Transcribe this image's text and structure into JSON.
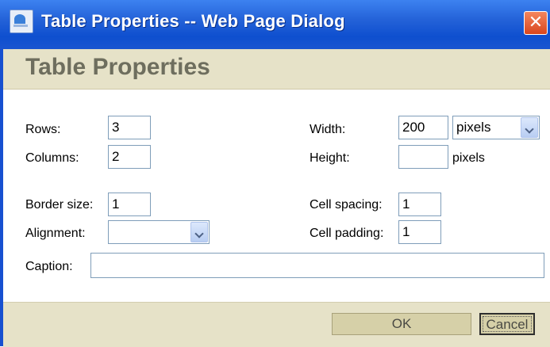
{
  "window": {
    "title": "Table Properties -- Web Page Dialog",
    "close_symbol": "✕",
    "icon": "dialog-app-icon"
  },
  "header": {
    "title": "Table Properties"
  },
  "form": {
    "rows": {
      "label": "Rows:",
      "value": "3"
    },
    "columns": {
      "label": "Columns:",
      "value": "2"
    },
    "border_size": {
      "label": "Border size:",
      "value": "1"
    },
    "alignment": {
      "label": "Alignment:",
      "value": ""
    },
    "caption": {
      "label": "Caption:",
      "value": ""
    },
    "width": {
      "label": "Width:",
      "value": "200",
      "unit": "pixels"
    },
    "height": {
      "label": "Height:",
      "value": "",
      "unit": "pixels"
    },
    "cell_spacing": {
      "label": "Cell spacing:",
      "value": "1"
    },
    "cell_padding": {
      "label": "Cell padding:",
      "value": "1"
    }
  },
  "buttons": {
    "ok": "OK",
    "cancel": "Cancel"
  },
  "colors": {
    "titlebar": "#0e4fcf",
    "band": "#e6e2c8",
    "button": "#d6d0a8",
    "close": "#d9461d"
  }
}
